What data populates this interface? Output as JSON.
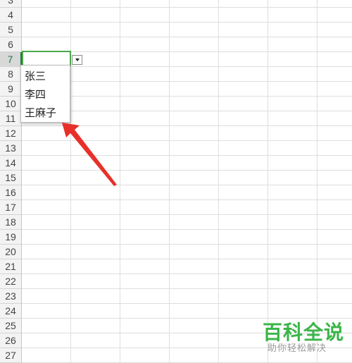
{
  "rows": [
    "3",
    "4",
    "5",
    "6",
    "7",
    "8",
    "9",
    "10",
    "11",
    "12",
    "13",
    "14",
    "15",
    "16",
    "17",
    "18",
    "19",
    "20",
    "21",
    "22",
    "23",
    "24",
    "25",
    "26",
    "27"
  ],
  "active_row": "7",
  "dropdown": {
    "items": [
      "张三",
      "李四",
      "王麻子"
    ],
    "button_icon": "dropdown-arrow-icon"
  },
  "annotation": {
    "arrow_color": "#e8302a",
    "icon": "red-arrow-icon"
  },
  "watermark": {
    "title": "百科全说",
    "subtitle": "助你轻松解决",
    "color": "#3bb54a"
  }
}
